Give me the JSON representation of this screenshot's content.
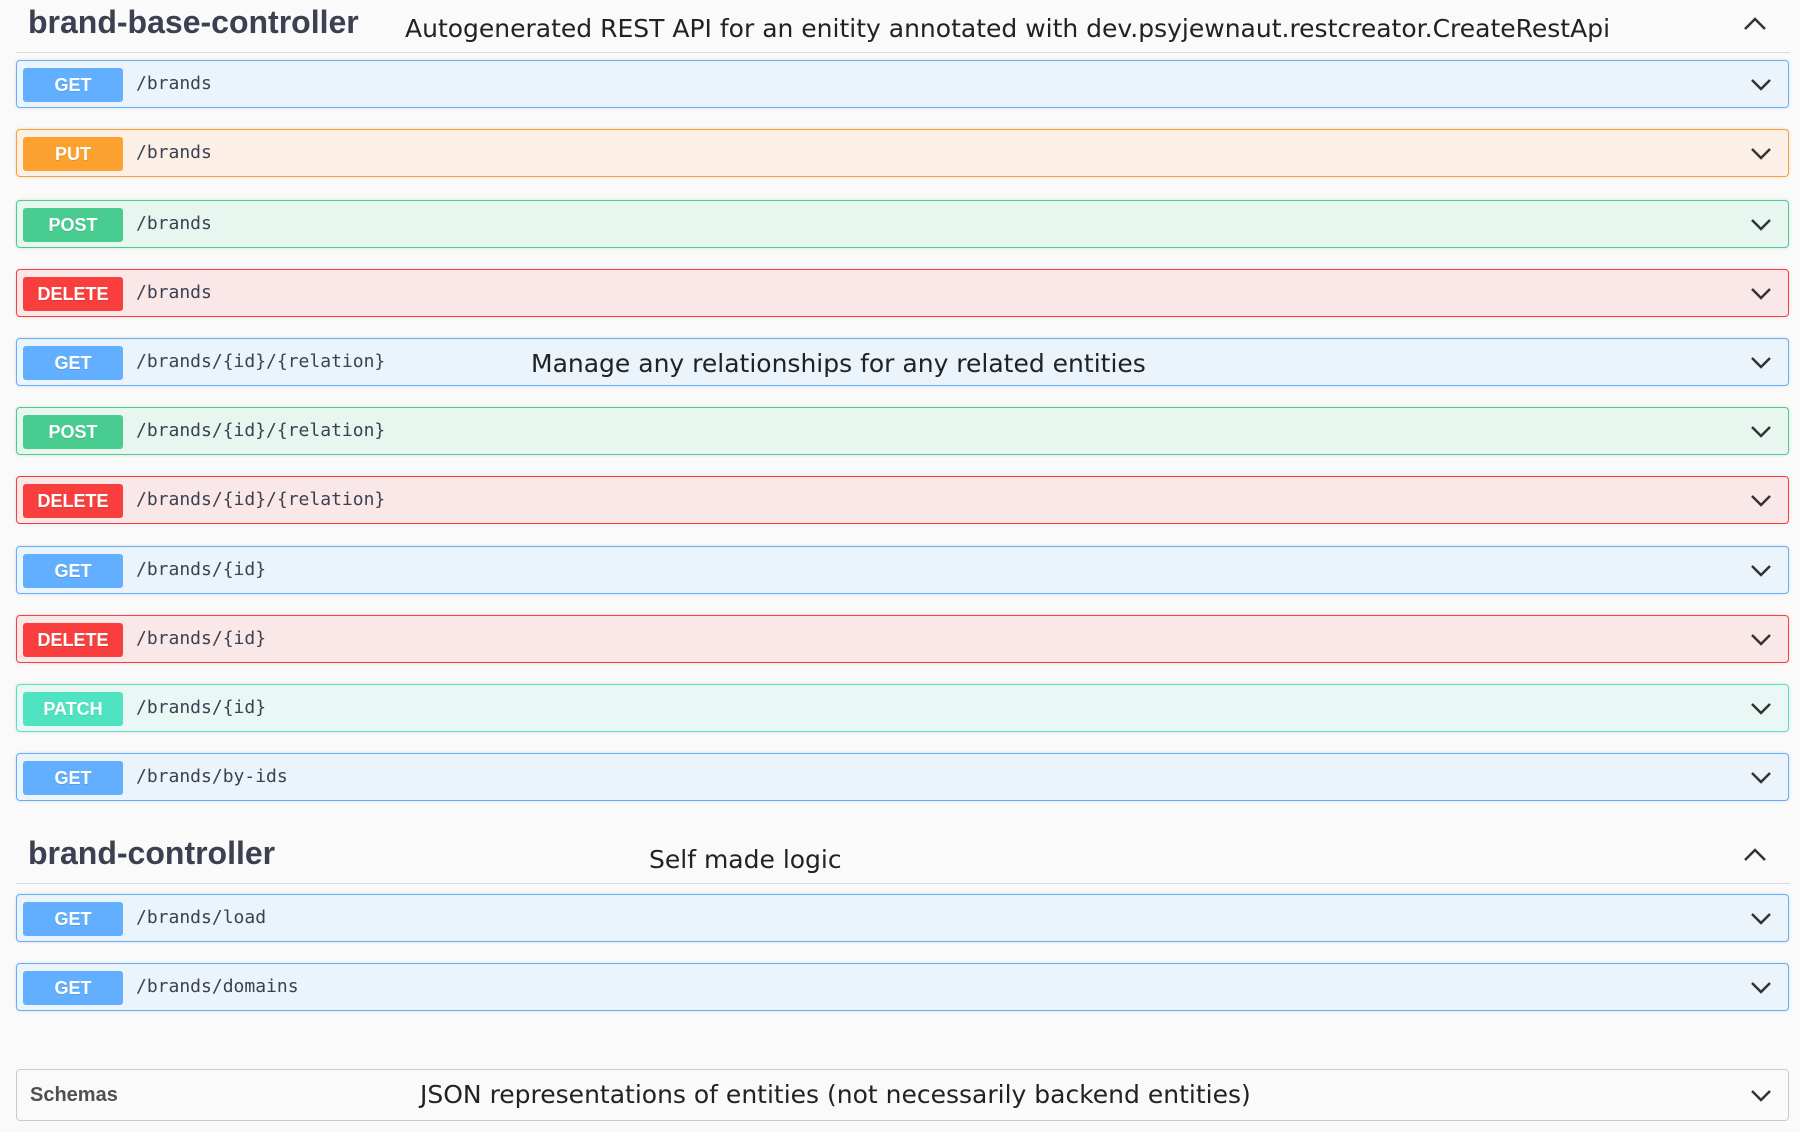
{
  "sections": [
    {
      "title": "brand-base-controller",
      "description": "Autogenerated REST API for an enitity annotated with dev.psyjewnaut.restcreator.CreateRestApi",
      "toggle_icon": "chevron-up-icon",
      "operations": [
        {
          "method": "GET",
          "path": "/brands",
          "summary": ""
        },
        {
          "method": "PUT",
          "path": "/brands",
          "summary": ""
        },
        {
          "method": "POST",
          "path": "/brands",
          "summary": ""
        },
        {
          "method": "DELETE",
          "path": "/brands",
          "summary": ""
        },
        {
          "method": "GET",
          "path": "/brands/{id}/{relation}",
          "summary": "Manage any relationships for any related entities"
        },
        {
          "method": "POST",
          "path": "/brands/{id}/{relation}",
          "summary": ""
        },
        {
          "method": "DELETE",
          "path": "/brands/{id}/{relation}",
          "summary": ""
        },
        {
          "method": "GET",
          "path": "/brands/{id}",
          "summary": ""
        },
        {
          "method": "DELETE",
          "path": "/brands/{id}",
          "summary": ""
        },
        {
          "method": "PATCH",
          "path": "/brands/{id}",
          "summary": ""
        },
        {
          "method": "GET",
          "path": "/brands/by-ids",
          "summary": ""
        }
      ]
    },
    {
      "title": "brand-controller",
      "description": "Self made logic",
      "toggle_icon": "chevron-up-icon",
      "operations": [
        {
          "method": "GET",
          "path": "/brands/load",
          "summary": ""
        },
        {
          "method": "GET",
          "path": "/brands/domains",
          "summary": ""
        }
      ]
    }
  ],
  "schemas": {
    "title": "Schemas",
    "description": "JSON representations of entities (not necessarily backend entities)",
    "toggle_icon": "chevron-down-icon"
  },
  "colors": {
    "get": "#61affe",
    "put": "#fca130",
    "post": "#49cc90",
    "delete": "#f93e3e",
    "patch": "#50e3c2"
  }
}
